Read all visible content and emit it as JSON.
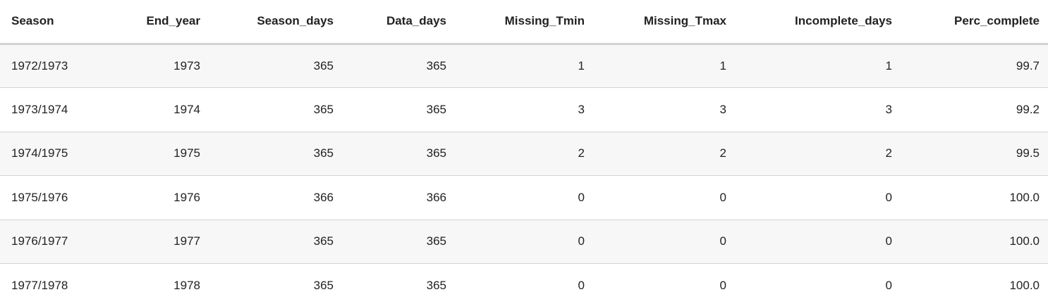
{
  "table": {
    "columns": [
      "Season",
      "End_year",
      "Season_days",
      "Data_days",
      "Missing_Tmin",
      "Missing_Tmax",
      "Incomplete_days",
      "Perc_complete"
    ],
    "rows": [
      [
        "1972/1973",
        "1973",
        "365",
        "365",
        "1",
        "1",
        "1",
        "99.7"
      ],
      [
        "1973/1974",
        "1974",
        "365",
        "365",
        "3",
        "3",
        "3",
        "99.2"
      ],
      [
        "1974/1975",
        "1975",
        "365",
        "365",
        "2",
        "2",
        "2",
        "99.5"
      ],
      [
        "1975/1976",
        "1976",
        "366",
        "366",
        "0",
        "0",
        "0",
        "100.0"
      ],
      [
        "1976/1977",
        "1977",
        "365",
        "365",
        "0",
        "0",
        "0",
        "100.0"
      ],
      [
        "1977/1978",
        "1978",
        "365",
        "365",
        "0",
        "0",
        "0",
        "100.0"
      ]
    ]
  },
  "colors": {
    "row_stripe": "#f7f7f7",
    "row_plain": "#ffffff",
    "border": "#d3d3d3",
    "text": "#222222"
  }
}
